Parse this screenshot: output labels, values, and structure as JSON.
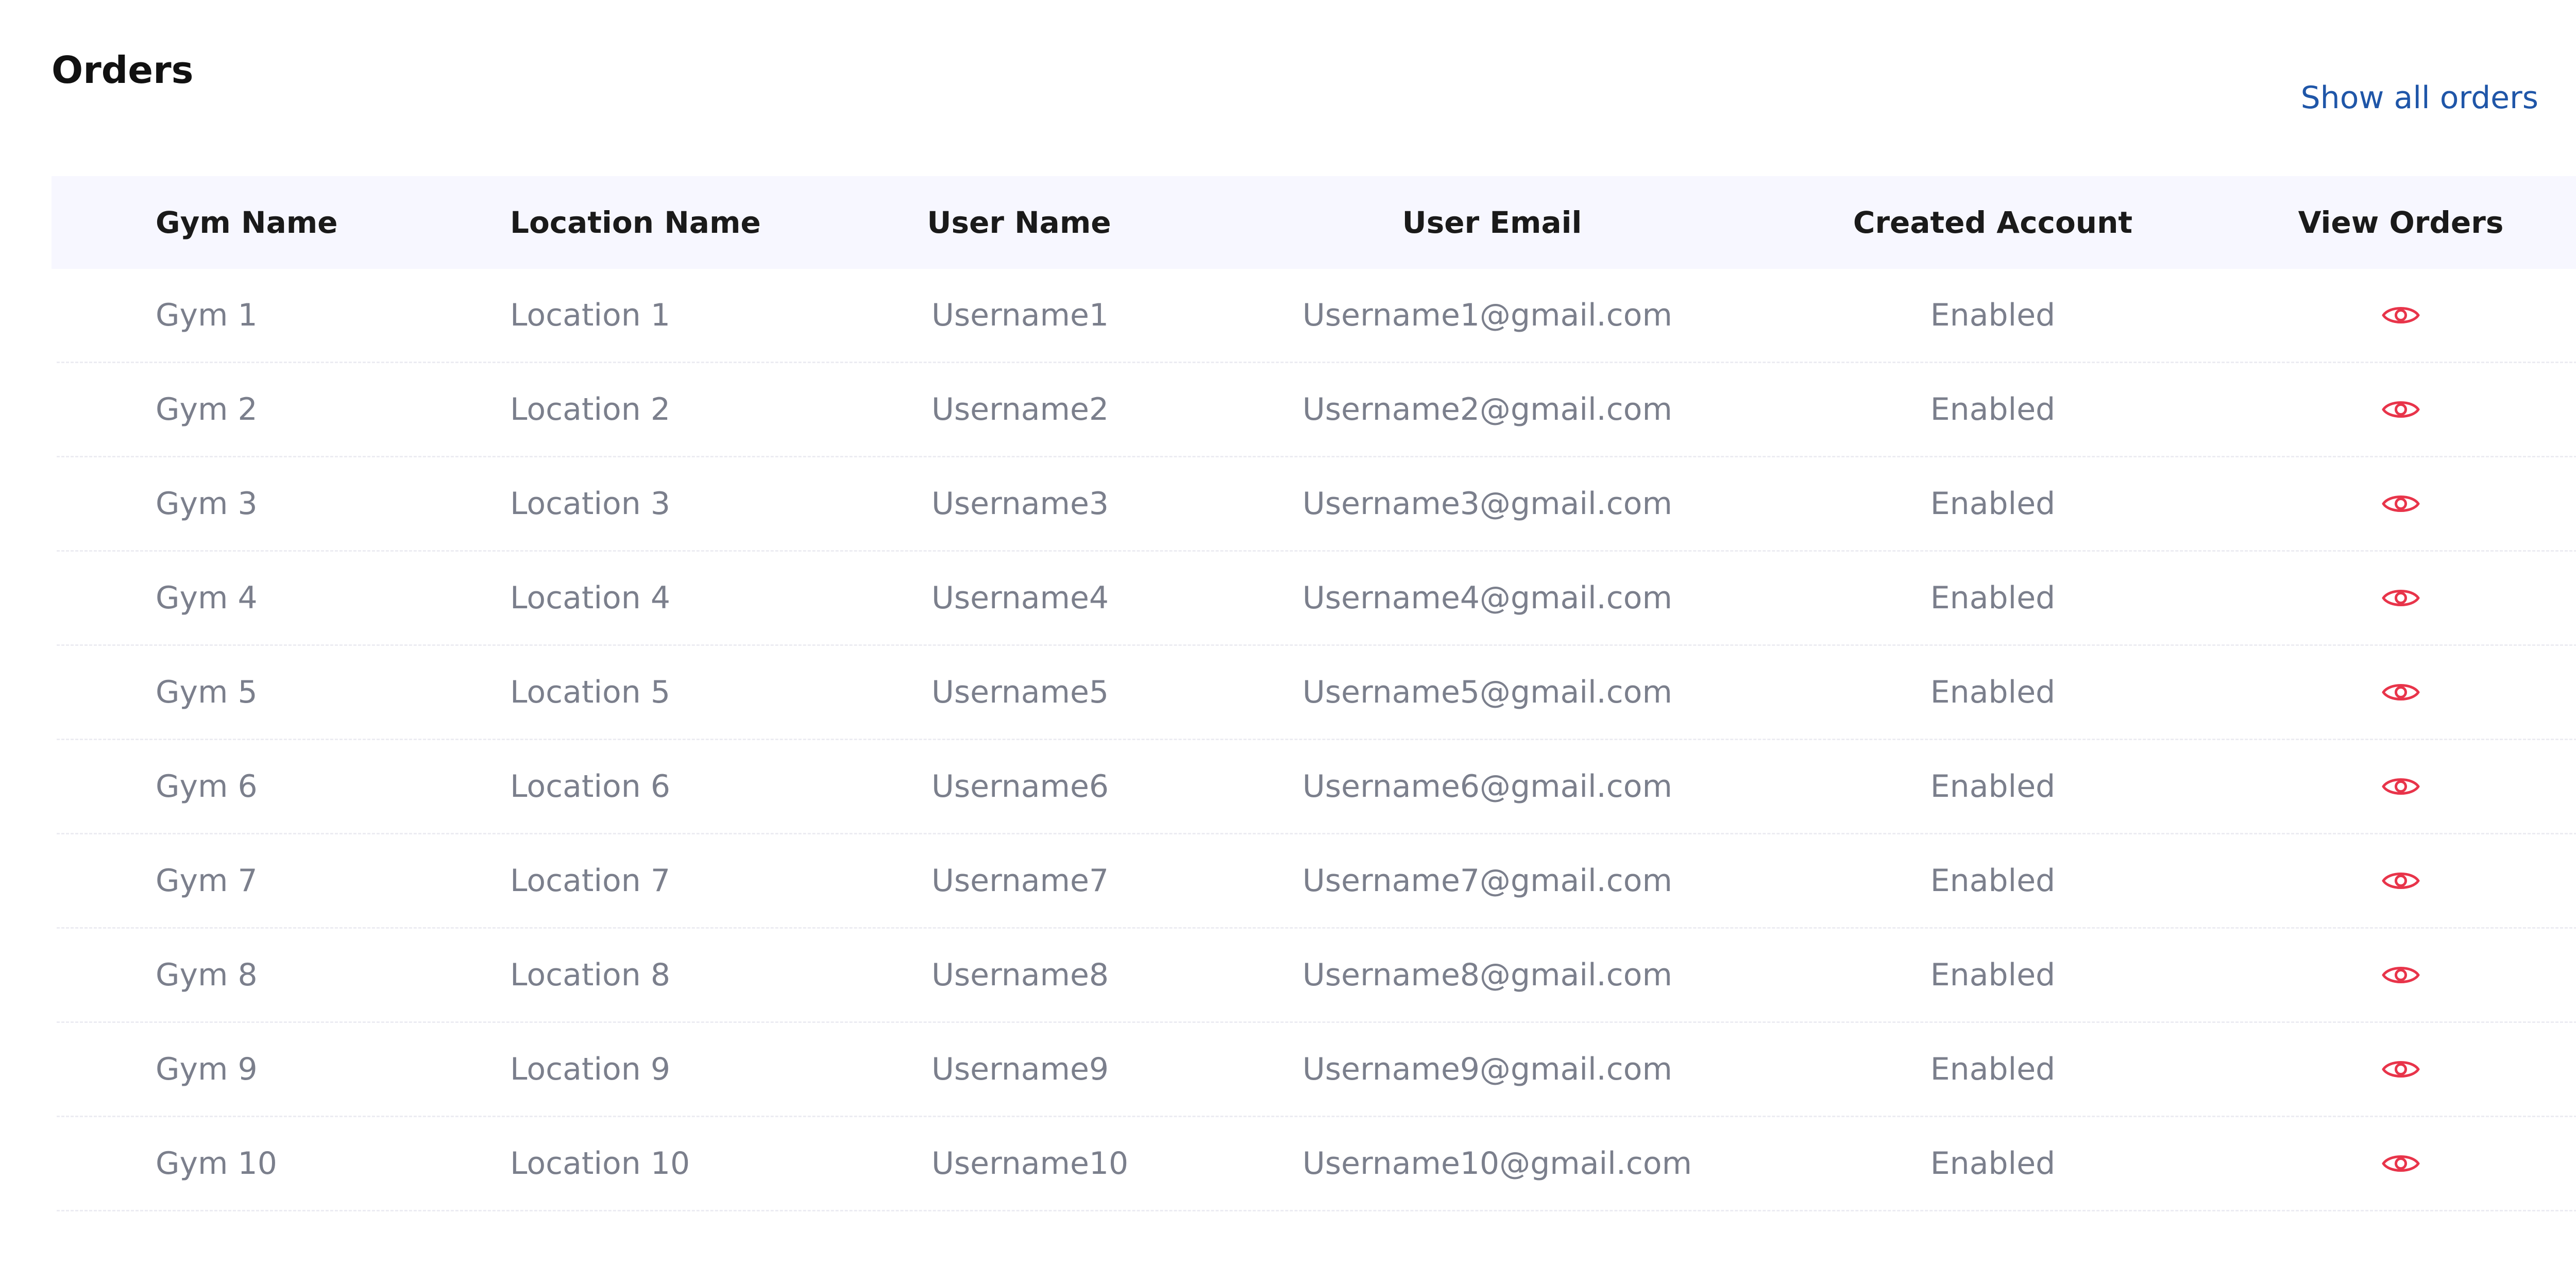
{
  "page": {
    "title": "Orders",
    "show_all_label": "Show all orders"
  },
  "table": {
    "headers": {
      "gym": "Gym Name",
      "location": "Location Name",
      "user": "User Name",
      "email": "User Email",
      "created": "Created Account",
      "view": "View Orders"
    },
    "rows": [
      {
        "gym": "Gym 1",
        "location": "Location 1",
        "user": "Username1",
        "email": "Username1@gmail.com",
        "created": "Enabled",
        "icon": "eye-icon"
      },
      {
        "gym": "Gym 2",
        "location": "Location 2",
        "user": "Username2",
        "email": "Username2@gmail.com",
        "created": "Enabled",
        "icon": "eye-icon"
      },
      {
        "gym": "Gym 3",
        "location": "Location 3",
        "user": "Username3",
        "email": "Username3@gmail.com",
        "created": "Enabled",
        "icon": "eye-icon"
      },
      {
        "gym": "Gym 4",
        "location": "Location 4",
        "user": "Username4",
        "email": "Username4@gmail.com",
        "created": "Enabled",
        "icon": "eye-icon"
      },
      {
        "gym": "Gym 5",
        "location": "Location 5",
        "user": "Username5",
        "email": "Username5@gmail.com",
        "created": "Enabled",
        "icon": "eye-icon"
      },
      {
        "gym": "Gym 6",
        "location": "Location 6",
        "user": "Username6",
        "email": "Username6@gmail.com",
        "created": "Enabled",
        "icon": "eye-icon"
      },
      {
        "gym": "Gym 7",
        "location": "Location 7",
        "user": "Username7",
        "email": "Username7@gmail.com",
        "created": "Enabled",
        "icon": "eye-icon"
      },
      {
        "gym": "Gym 8",
        "location": "Location 8",
        "user": "Username8",
        "email": "Username8@gmail.com",
        "created": "Enabled",
        "icon": "eye-icon"
      },
      {
        "gym": "Gym 9",
        "location": "Location 9",
        "user": "Username9",
        "email": "Username9@gmail.com",
        "created": "Enabled",
        "icon": "eye-icon"
      },
      {
        "gym": "Gym 10",
        "location": "Location 10",
        "user": "Username10",
        "email": "Username10@gmail.com",
        "created": "Enabled",
        "icon": "eye-icon"
      }
    ]
  },
  "colors": {
    "link": "#1f56a8",
    "icon": "#e8344a",
    "header_bg": "#f7f7ff",
    "muted_text": "#7b7f8c"
  }
}
